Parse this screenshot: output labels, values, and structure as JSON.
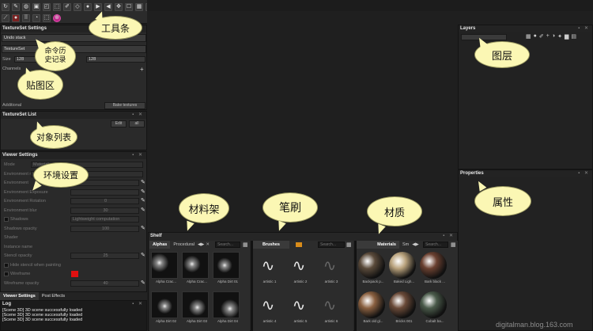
{
  "toolbar": {
    "row1": [
      "↻",
      "✎",
      "◍",
      "▣",
      "◰",
      "⬚",
      "✐",
      "◇",
      "●",
      "▶",
      "◀",
      "✥",
      "☐",
      "▦",
      "⇲",
      "▙",
      "◢"
    ],
    "row2": [
      "⟋",
      "●",
      "⠿",
      "◔",
      "⬚",
      "⊕"
    ]
  },
  "textureset_settings": {
    "title": "TextureSet Settings",
    "undo_label": "Undo stack",
    "texture_set_value": "TextureSet",
    "size_label": "Size",
    "size_value": "128",
    "size_value2": "128",
    "channels_label": "Channels",
    "additional_label": "Additional",
    "bake_button": "Bake textures"
  },
  "textureset_list": {
    "title": "TextureSet List",
    "buttons": [
      "Edit",
      "all"
    ]
  },
  "viewer_settings": {
    "title": "Viewer Settings",
    "rows": [
      {
        "label": "Mode",
        "value": "Material"
      },
      {
        "label": "Environment map",
        "value": "panorama"
      },
      {
        "label": "Environment",
        "value": ""
      },
      {
        "label": "Environment Exposure",
        "value": ""
      },
      {
        "label": "Environment Rotation",
        "value": "0"
      },
      {
        "label": "Environment blur",
        "value": "30"
      },
      {
        "label": "Shadows",
        "value": "Lightweight computation"
      },
      {
        "label": "Shadows opacity",
        "value": "100"
      },
      {
        "label": "Shader",
        "value": ""
      },
      {
        "label": "Instance name",
        "value": ""
      },
      {
        "label": "Stencil opacity",
        "value": "25"
      },
      {
        "label": "Hide stencil when painting",
        "value": ""
      },
      {
        "label": "Wireframe",
        "value": ""
      },
      {
        "label": "Wireframe opacity",
        "value": "40"
      }
    ],
    "tabs": [
      "Viewer Settings",
      "Post Effects"
    ]
  },
  "log": {
    "title": "Log",
    "lines": [
      "[Scene 3D] 3D scene successfully loaded",
      "[Scene 3D] 3D scene successfully loaded",
      "[Scene 3D] 3D scene successfully loaded"
    ]
  },
  "layers": {
    "title": "Layers"
  },
  "properties": {
    "title": "Properties"
  },
  "shelf": {
    "title": "Shelf",
    "alphas": {
      "tabs": [
        "Alphas",
        "Procedural"
      ],
      "search": "Search...",
      "items": [
        "Alpha Crac...",
        "Alpha Crac...",
        "Alpha Dirt 01",
        "Alpha Dirt 02",
        "Alpha Dirt 03",
        "Alpha Dirt 04"
      ]
    },
    "brushes": {
      "tabs": [
        "Brushes"
      ],
      "search": "Search...",
      "items": [
        "artistic 1",
        "artistic 2",
        "artistic 3",
        "artistic 4",
        "artistic 5",
        "artistic 6"
      ]
    },
    "materials": {
      "tabs": [
        "Materials",
        "Sm"
      ],
      "search": "Search...",
      "items": [
        "Backpack p...",
        "Baked Ligh...",
        "Bark black ...",
        "Bark old gl...",
        "Bricks 001",
        "Cobalt ba..."
      ]
    }
  },
  "callouts": {
    "toolbar": "工具条",
    "history": "命令历\n史记录",
    "texture": "贴图区",
    "objects": "对象列表",
    "environment": "环境设置",
    "layers": "图层",
    "properties": "属性",
    "materials_shelf": "材料架",
    "brush": "笔刷",
    "material": "材质"
  },
  "watermark": "digitalman.blog.163.com",
  "colors": {
    "callout": "#fbf7b4",
    "wireframe": "#e01010",
    "accent_pink": "#c02a8c"
  }
}
